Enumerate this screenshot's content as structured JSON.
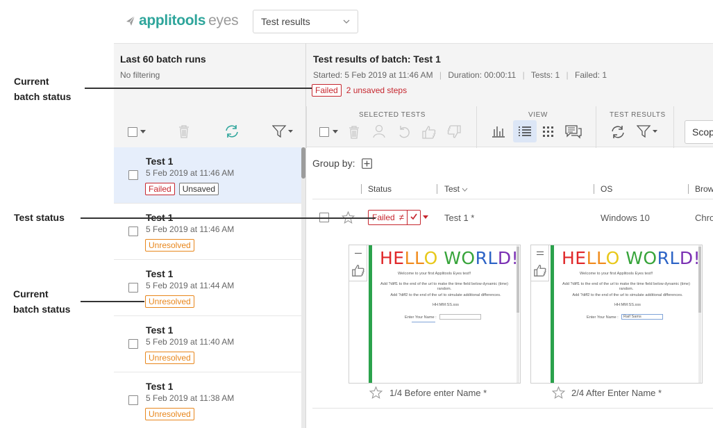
{
  "header": {
    "logo_main": "applitools",
    "logo_sub": "eyes",
    "view_select": "Test results"
  },
  "left": {
    "title": "Last 60 batch runs",
    "subtitle": "No filtering",
    "batches": [
      {
        "name": "Test 1",
        "date": "5 Feb 2019 at 11:46 AM",
        "badges": [
          "Failed",
          "Unsaved"
        ]
      },
      {
        "name": "Test 1",
        "date": "5 Feb 2019 at 11:46 AM",
        "badges": [
          "Unresolved"
        ]
      },
      {
        "name": "Test 1",
        "date": "5 Feb 2019 at 11:44 AM",
        "badges": [
          "Unresolved"
        ]
      },
      {
        "name": "Test 1",
        "date": "5 Feb 2019 at 11:40 AM",
        "badges": [
          "Unresolved"
        ]
      },
      {
        "name": "Test 1",
        "date": "5 Feb 2019 at 11:38 AM",
        "badges": [
          "Unresolved"
        ]
      }
    ]
  },
  "right": {
    "title": "Test results of batch:  Test 1",
    "started": "Started: 5 Feb 2019 at 11:46 AM",
    "duration": "Duration: 00:00:11",
    "tests": "Tests: 1",
    "failed": "Failed: 1",
    "status_badge": "Failed",
    "unsaved": "2 unsaved steps",
    "toolbar": {
      "selected_tests": "SELECTED TESTS",
      "view": "VIEW",
      "test_results": "TEST RESULTS",
      "scope": "Scop"
    },
    "group_by": "Group by:",
    "columns": {
      "status": "Status",
      "test": "Test",
      "os": "OS",
      "browser": "Brow"
    },
    "row": {
      "status": "Failed",
      "test": "Test 1 *",
      "os": "Windows 10",
      "browser": "Chro"
    },
    "thumbnails": [
      {
        "caption": "1/4 Before enter Name *",
        "hello": "HELLO WORLD!",
        "welcome": "Welcome to your first Applitools Eyes test!!",
        "add1": "Add ?diff1 to the end of the url to make the time field below dynamic (time) random.",
        "add2": "Add ?diff2 to the end of the url to simulate additional differences.",
        "time": "HH:MM:SS.sss",
        "enter": "Enter Your Name :",
        "name_value": ""
      },
      {
        "caption": "2/4 After Enter Name *",
        "hello": "HELLO WORLD!",
        "welcome": "Welcome to your first Applitools Eyes test!!",
        "add1": "Add ?diff1 to the end of the url to make the time field below dynamic (time) random.",
        "add2": "Add ?diff2 to the end of the url to simulate additional differences.",
        "time": "HH:MM:SS.sss",
        "enter": "Enter Your Name :",
        "name_value": "Raif Sams"
      }
    ]
  },
  "annotations": {
    "current_batch_status": "Current\nbatch status",
    "test_status": "Test status",
    "current_batch_status_2": "Current\nbatch status"
  },
  "colors": {
    "teal": "#2ea59b",
    "failed": "#c6262e",
    "unresolved": "#e8861b",
    "selected_row": "#e6eefb"
  }
}
